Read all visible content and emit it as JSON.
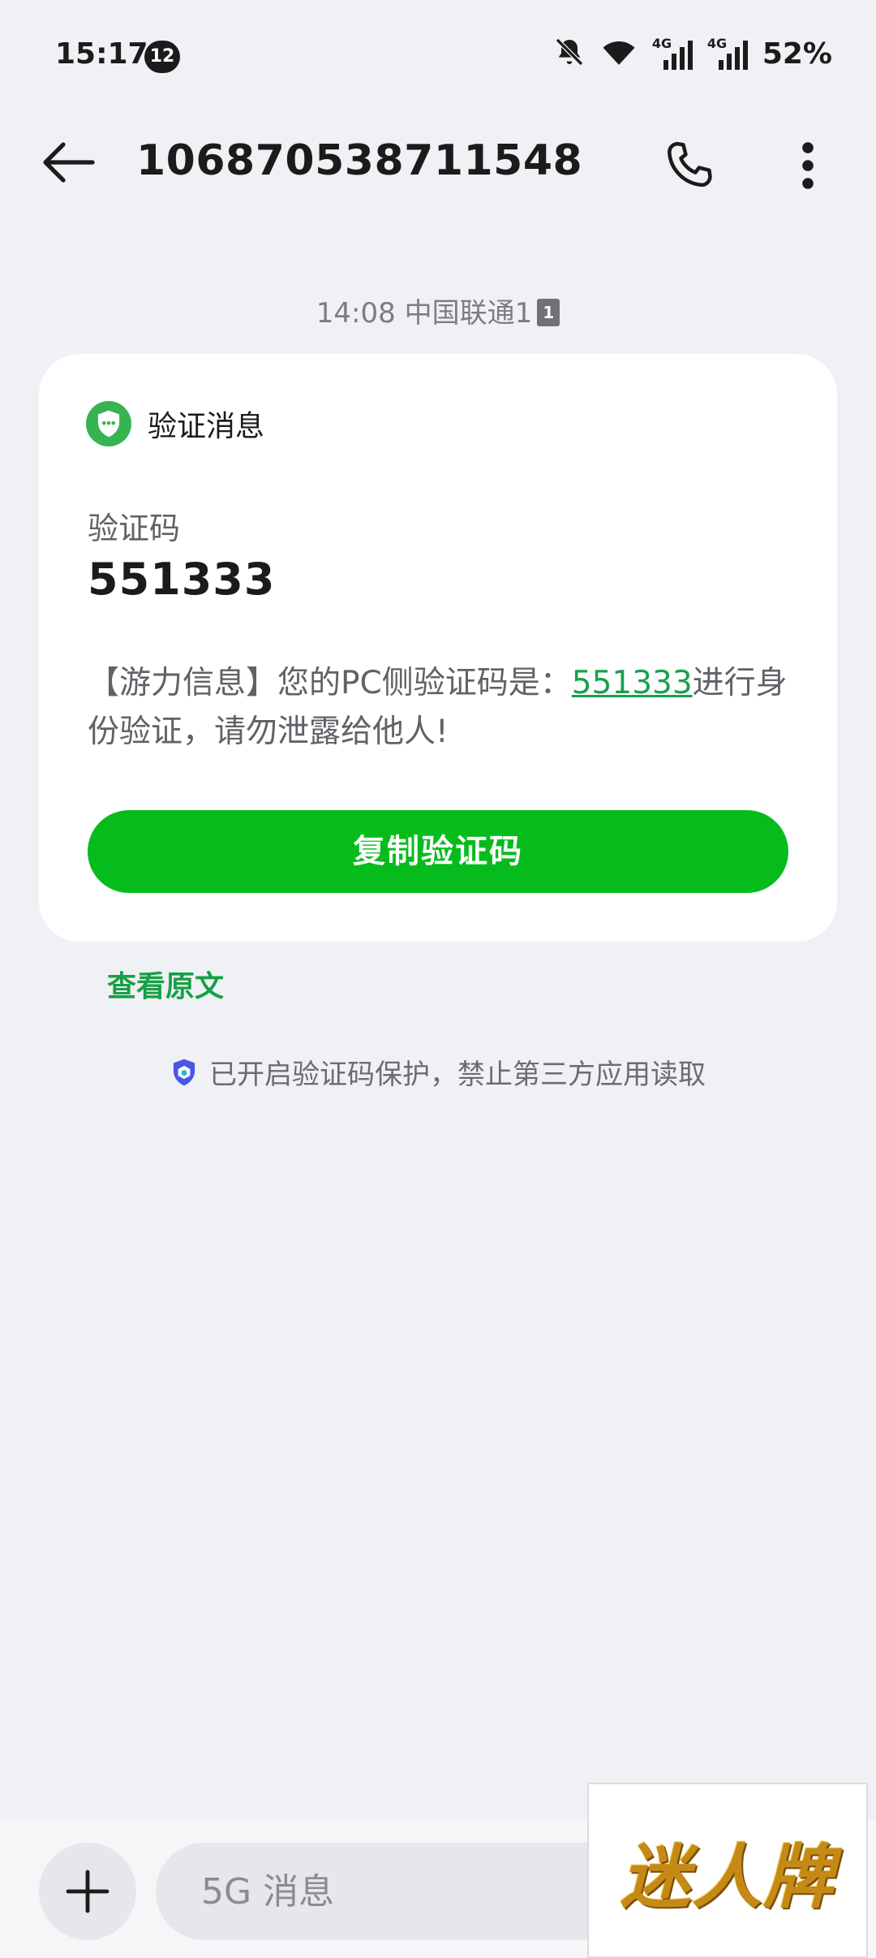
{
  "status_bar": {
    "time": "15:17",
    "notification_count": "12",
    "network_1": "4G",
    "network_2": "4G",
    "battery": "52%"
  },
  "header": {
    "title": "106870538711548"
  },
  "message": {
    "meta": "14:08 中国联通1",
    "sim_slot": "1",
    "card_title": "验证消息",
    "code_label": "验证码",
    "code_value": "551333",
    "body_before": "【游力信息】您的PC侧验证码是：",
    "body_code": "551333",
    "body_after": "进行身份验证，请勿泄露给他人!",
    "copy_button": "复制验证码",
    "view_original": "查看原文",
    "protection_note": "已开启验证码保护，禁止第三方应用读取"
  },
  "composer": {
    "placeholder": "5G 消息"
  },
  "watermark": {
    "text": "迷人牌"
  },
  "colors": {
    "accent_green": "#05bc1c",
    "link_green": "#19a04b",
    "background": "#eff1f4"
  }
}
